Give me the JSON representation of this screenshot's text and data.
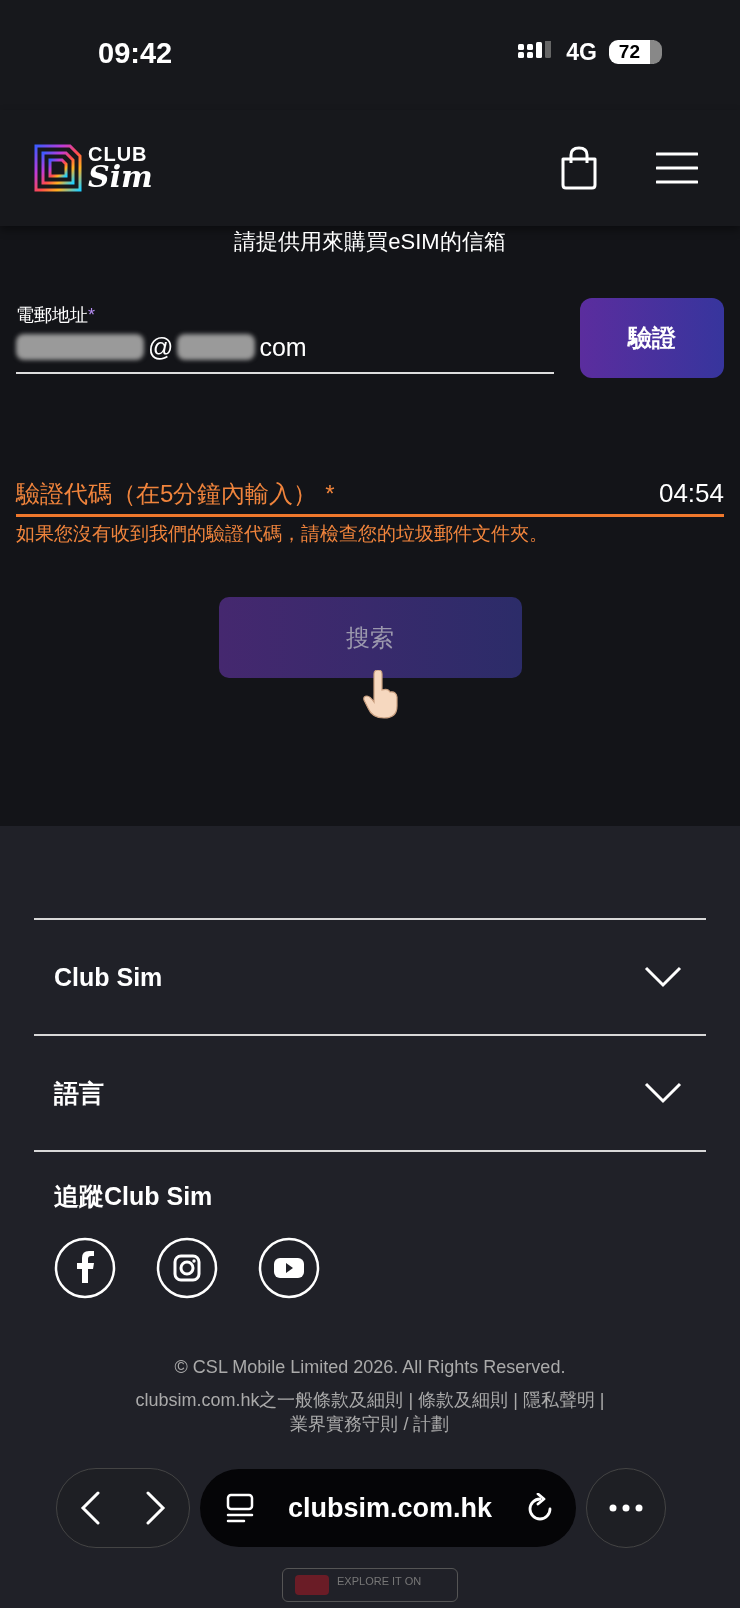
{
  "status_bar": {
    "time": "09:42",
    "network": "4G",
    "battery": "72"
  },
  "header": {
    "logo_top": "CLUB",
    "logo_bottom": "Sim"
  },
  "form": {
    "title": "請提供用來購買eSIM的信箱",
    "email": {
      "label": "電郵地址",
      "required_mark": "*",
      "value_parts": [
        "@",
        "com"
      ]
    },
    "verify_button": "驗證",
    "code": {
      "label": "驗證代碼（在5分鐘內輸入）",
      "required_mark": "*",
      "timer": "04:54",
      "error": "如果您沒有收到我們的驗證代碼，請檢查您的垃圾郵件文件夾。"
    },
    "search_button": {
      "label": "搜索",
      "disabled": true
    }
  },
  "footer": {
    "sections": [
      {
        "title": "Club Sim",
        "expanded": false
      },
      {
        "title": "語言",
        "expanded": false
      }
    ],
    "follow_title": "追蹤Club Sim",
    "social": [
      {
        "kind": "facebook"
      },
      {
        "kind": "instagram"
      },
      {
        "kind": "youtube"
      }
    ],
    "copyright": "© CSL Mobile Limited 2026. All Rights Reserved.",
    "legal_lines": [
      "clubsim.com.hk之一般條款及細則 | 條款及細則 | 隱私聲明 |",
      "業界實務守則 / 計劃"
    ],
    "store_badge": "EXPLORE IT ON"
  },
  "browser": {
    "url": "clubsim.com.hk"
  }
}
